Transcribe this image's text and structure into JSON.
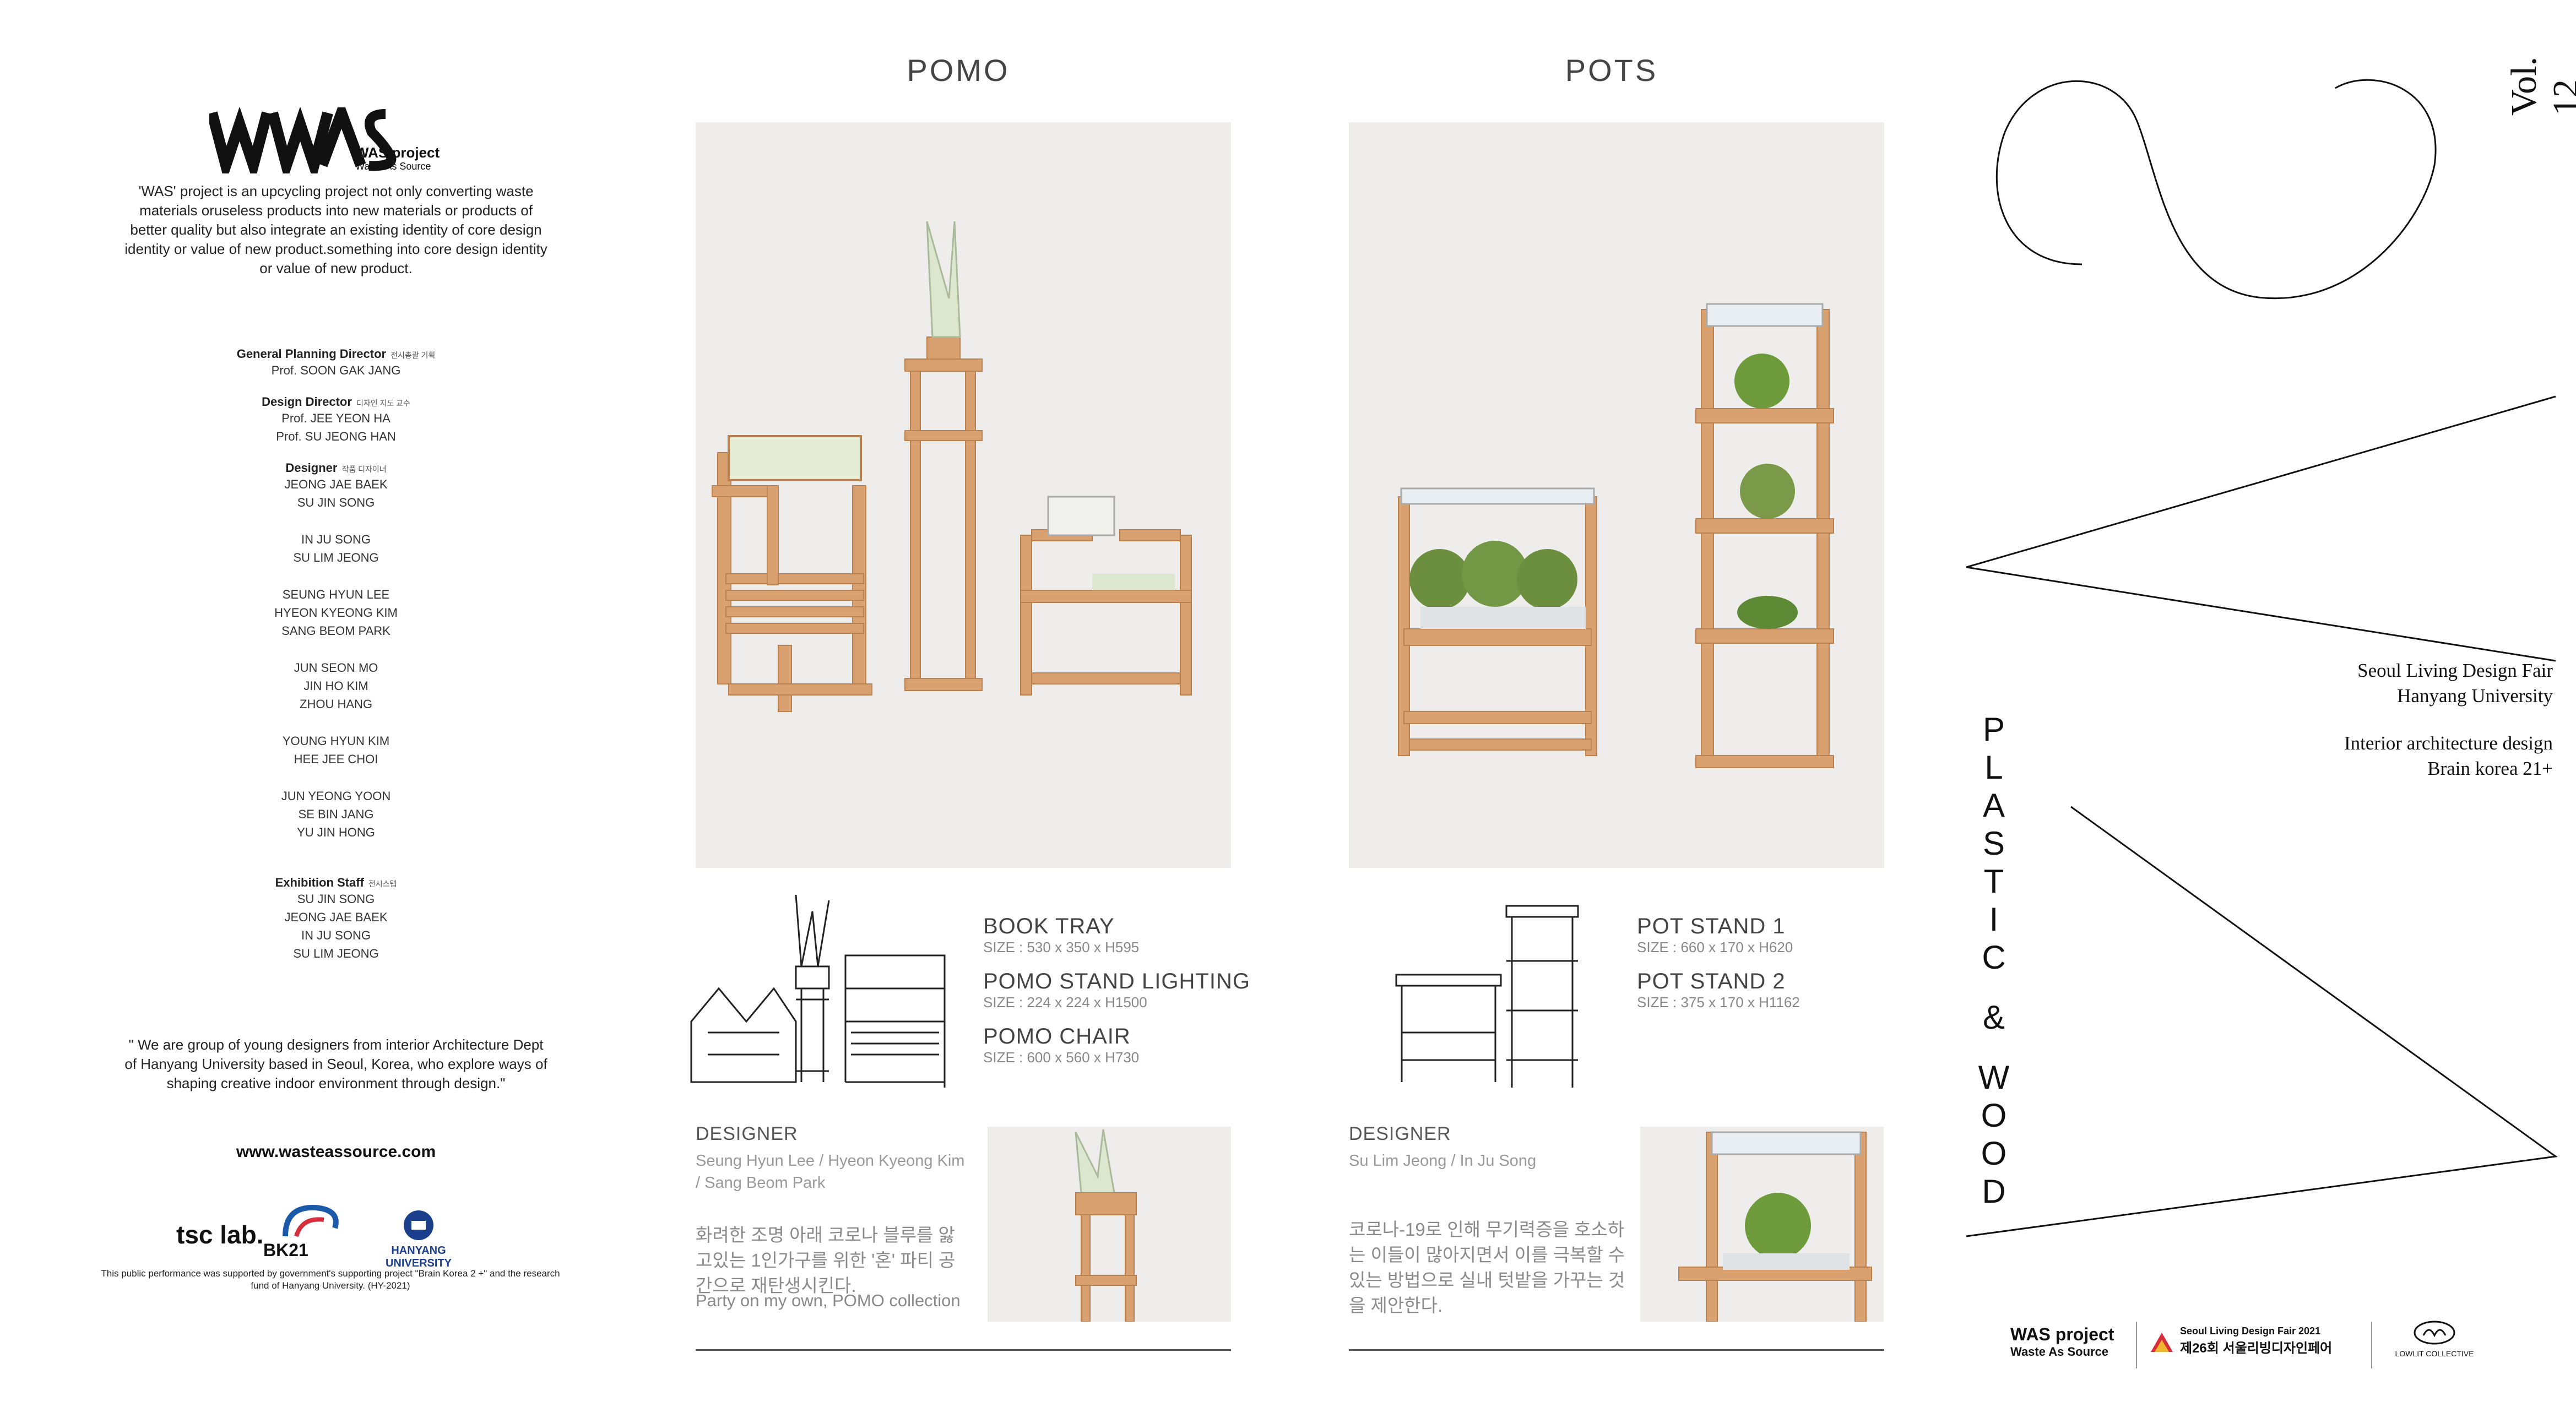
{
  "left": {
    "logo_text": "WAS",
    "logo_small": "WAS project",
    "logo_sub": "Waste As Source",
    "intro": "'WAS' project is an upcycling project not only converting waste materials oruseless products into new materials or products of better quality but also integrate an existing identity of  core design identity or value of new product.something into  core design identity or value of new product.",
    "credits": [
      {
        "role": "General Planning Director",
        "role_kr": "전시총괄 기획",
        "names": [
          "Prof. SOON GAK JANG"
        ]
      },
      {
        "role": "Design Director",
        "role_kr": "디자인 지도 교수",
        "names": [
          "Prof. JEE YEON HA",
          "Prof. SU JEONG HAN"
        ]
      },
      {
        "role": "Designer",
        "role_kr": "작품 디자이너",
        "names": [
          "JEONG JAE BAEK",
          "SU JIN SONG"
        ]
      }
    ],
    "designer_groups": [
      [
        "IN JU SONG",
        "SU LIM JEONG"
      ],
      [
        "SEUNG HYUN LEE",
        "HYEON KYEONG KIM",
        "SANG BEOM PARK"
      ],
      [
        "JUN SEON MO",
        "JIN HO KIM",
        "ZHOU HANG"
      ],
      [
        "YOUNG HYUN KIM",
        "HEE JEE CHOI"
      ],
      [
        "JUN YEONG YOON",
        "SE BIN JANG",
        "YU JIN HONG"
      ]
    ],
    "staff": {
      "role": "Exhibition Staff",
      "role_kr": "전시스탭",
      "names": [
        "SU JIN SONG",
        "JEONG JAE BAEK",
        "IN JU SONG",
        "SU LIM JEONG"
      ]
    },
    "quote": "\" We are group of young designers  from interior Architecture Dept of Hanyang University based in Seoul, Korea, who explore ways of shaping creative indoor environment through design.\"",
    "url": "www.wasteassource.com",
    "sponsors": {
      "tsc": "tsc lab.",
      "bk21": "BK21",
      "hanyang": "HANYANG UNIVERSITY"
    },
    "support": "This public performance was supported by government's supporting project \"Brain Korea 2  +\" and the research fund of Hanyang University. (HY-2021)"
  },
  "pomo": {
    "title": "POMO",
    "products": [
      {
        "name": "BOOK TRAY",
        "size": "SIZE : 530 x 350 x H595"
      },
      {
        "name": "POMO STAND LIGHTING",
        "size": "SIZE : 224 x 224 x H1500"
      },
      {
        "name": "POMO CHAIR",
        "size": "SIZE : 600 x 560 x H730"
      }
    ],
    "designer_label": "DESIGNER",
    "designers": "Seung Hyun Lee / Hyeon Kyeong Kim / Sang Beom Park",
    "kor": "화려한 조명 아래 코로나 블루를 앓고있는 1인가구를 위한 '혼' 파티 공간으로 재탄생시킨다.",
    "en": "Party on my own, POMO collection"
  },
  "pots": {
    "title": "POTS",
    "products": [
      {
        "name": "POT STAND 1",
        "size": "SIZE : 660 x 170 x H620"
      },
      {
        "name": "POT STAND 2",
        "size": "SIZE : 375 x 170 x H1162"
      }
    ],
    "designer_label": "DESIGNER",
    "designers": "Su Lim Jeong / In Ju Song",
    "kor": "코로나-19로 인해 무기력증을 호소하는 이들이 많아지면서 이를 극복할 수 있는 방법으로 실내 텃밭을 가꾸는 것을 제안한다."
  },
  "right": {
    "vol": "Vol. 12",
    "fair": [
      "Seoul Living Design Fair",
      "Hanyang University"
    ],
    "dept": [
      "Interior architecture design",
      "Brain korea 21+"
    ],
    "vertical_letters": [
      "P",
      "L",
      "A",
      "S",
      "T",
      "I",
      "C",
      "&",
      "W",
      "O",
      "O",
      "D"
    ],
    "footer": {
      "was": "WAS project",
      "was_sub": "Waste As Source",
      "fair_en": "Seoul Living Design Fair 2021",
      "fair_kr": "제26회 서울리빙디자인페어",
      "lowlit": "LOWLIT COLLECTIVE"
    }
  },
  "colors": {
    "wood": "#d9a170",
    "photo_bg": "#efedeb",
    "text": "#444444"
  }
}
